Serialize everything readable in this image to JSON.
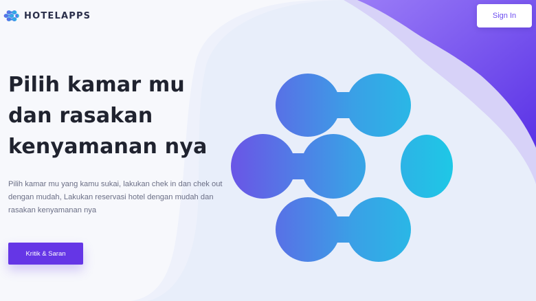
{
  "brand": {
    "name": "HOTELAPPS",
    "icon": "molecule-logo-icon"
  },
  "header": {
    "signin_label": "Sign In"
  },
  "hero": {
    "title_lines": [
      "Pilih kamar mu",
      "dan rasakan",
      "kenyamanan nya"
    ],
    "description": "Pilih kamar mu yang kamu sukai, lakukan chek in dan chek out dengan mudah, Lakukan reservasi hotel dengan mudah dan rasakan kenyamanan nya",
    "cta_label": "Kritik & Saran",
    "illustration_icon": "molecule-logo-icon"
  },
  "colors": {
    "accent": "#6536e6",
    "gradient_start": "#6a55e6",
    "gradient_end": "#1ec8e6",
    "corner_purple": "#6a3cf0",
    "blob": "#e8eefa"
  }
}
